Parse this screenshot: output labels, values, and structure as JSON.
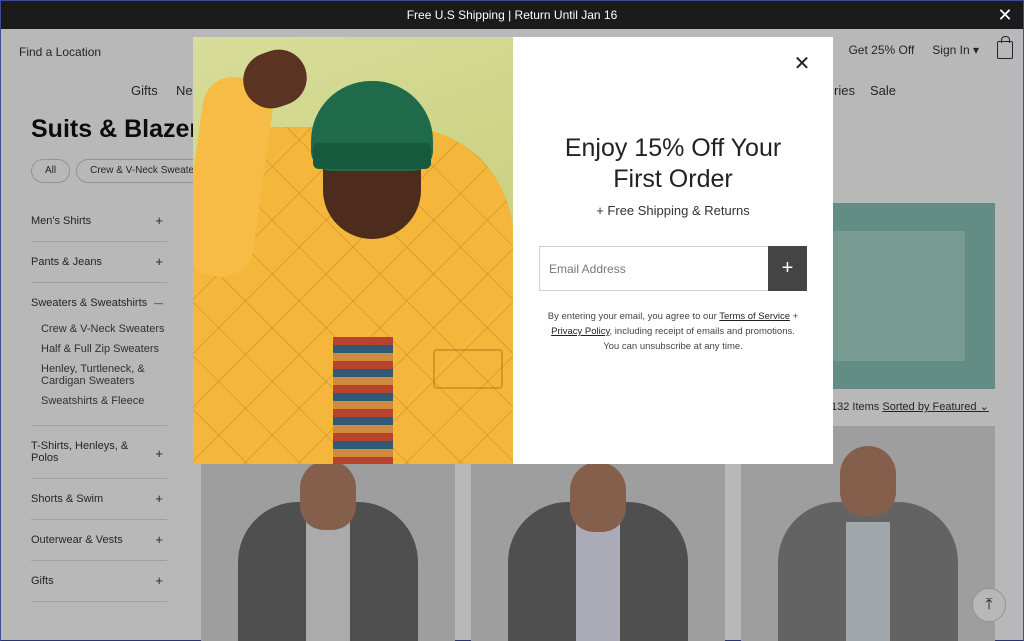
{
  "promo_bar": {
    "text": "Free U.S Shipping | Return Until Jan 16",
    "close": "✕"
  },
  "header": {
    "find_location": "Find a Location",
    "get_off": "Get 25% Off",
    "sign_in": "Sign In ▾"
  },
  "nav": {
    "gifts": "Gifts",
    "new": "Ne",
    "accessories": "ries",
    "sale": "Sale"
  },
  "page": {
    "title": "Suits & Blazer",
    "chips": [
      "All",
      "Crew & V-Neck Sweaters"
    ]
  },
  "sidebar": {
    "mens_shirts": "Men's Shirts",
    "pants_jeans": "Pants & Jeans",
    "sweaters": "Sweaters & Sweatshirts",
    "sub_crew": "Crew & V-Neck Sweaters",
    "sub_half": "Half & Full Zip Sweaters",
    "sub_henley": "Henley, Turtleneck, & Cardigan Sweaters",
    "sub_sweatshirts": "Sweatshirts & Fleece",
    "tshirts": "T-Shirts, Henleys, & Polos",
    "shorts": "Shorts & Swim",
    "outerwear": "Outerwear & Vests",
    "gifts": "Gifts",
    "plus": "+",
    "minus": "—"
  },
  "results": {
    "count": "132 Items",
    "sort": "Sorted by Featured ⌄"
  },
  "scroll_top": "⤒",
  "modal": {
    "close": "✕",
    "heading_line1": "Enjoy 15% Off Your",
    "heading_line2": "First Order",
    "subheading": "+ Free Shipping & Returns",
    "email_placeholder": "Email Address",
    "submit": "+",
    "disclaimer_prefix": "By entering your email, you agree to our ",
    "terms": "Terms of Service",
    "plus_sep": " +",
    "privacy": "Privacy Policy",
    "disclaimer_mid": ", including receipt of emails and promotions.",
    "disclaimer_end": "You can unsubscribe at any time."
  }
}
